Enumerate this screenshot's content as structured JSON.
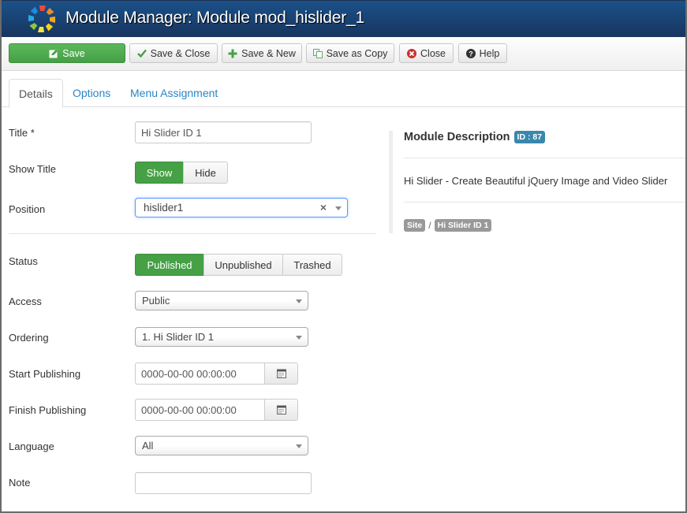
{
  "header": {
    "title": "Module Manager: Module mod_hislider_1",
    "logo_icon": "joomla-logo-icon"
  },
  "toolbar": {
    "buttons": [
      {
        "label": "Save",
        "icon": "edit-icon"
      },
      {
        "label": "Save & Close",
        "icon": "check-icon"
      },
      {
        "label": "Save & New",
        "icon": "plus-icon"
      },
      {
        "label": "Save as Copy",
        "icon": "copy-icon"
      },
      {
        "label": "Close",
        "icon": "close-circle-icon"
      },
      {
        "label": "Help",
        "icon": "question-circle-icon"
      }
    ]
  },
  "tabs": [
    {
      "label": "Details",
      "active": true
    },
    {
      "label": "Options",
      "active": false
    },
    {
      "label": "Menu Assignment",
      "active": false
    }
  ],
  "form": {
    "title": {
      "label": "Title *",
      "value": "Hi Slider ID 1"
    },
    "show_title": {
      "label": "Show Title",
      "options": [
        "Show",
        "Hide"
      ],
      "selected": "Show"
    },
    "position": {
      "label": "Position",
      "value": "hislider1"
    },
    "status": {
      "label": "Status",
      "options": [
        "Published",
        "Unpublished",
        "Trashed"
      ],
      "selected": "Published"
    },
    "access": {
      "label": "Access",
      "value": "Public"
    },
    "ordering": {
      "label": "Ordering",
      "value": "1. Hi Slider ID 1"
    },
    "start_publishing": {
      "label": "Start Publishing",
      "value": "0000-00-00 00:00:00"
    },
    "finish_publishing": {
      "label": "Finish Publishing",
      "value": "0000-00-00 00:00:00"
    },
    "language": {
      "label": "Language",
      "value": "All"
    },
    "note": {
      "label": "Note",
      "value": ""
    }
  },
  "description": {
    "heading": "Module Description",
    "id_badge": "ID : 87",
    "text": "Hi Slider - Create Beautiful jQuery Image and Video Slider",
    "breadcrumb": [
      "Site",
      "Hi Slider ID 1"
    ],
    "separator": "/"
  },
  "colors": {
    "header_top": "#1a5189",
    "header_bottom": "#18355f",
    "success": "#46a046",
    "info_badge": "#3a87ad",
    "link": "#2a85c5"
  }
}
